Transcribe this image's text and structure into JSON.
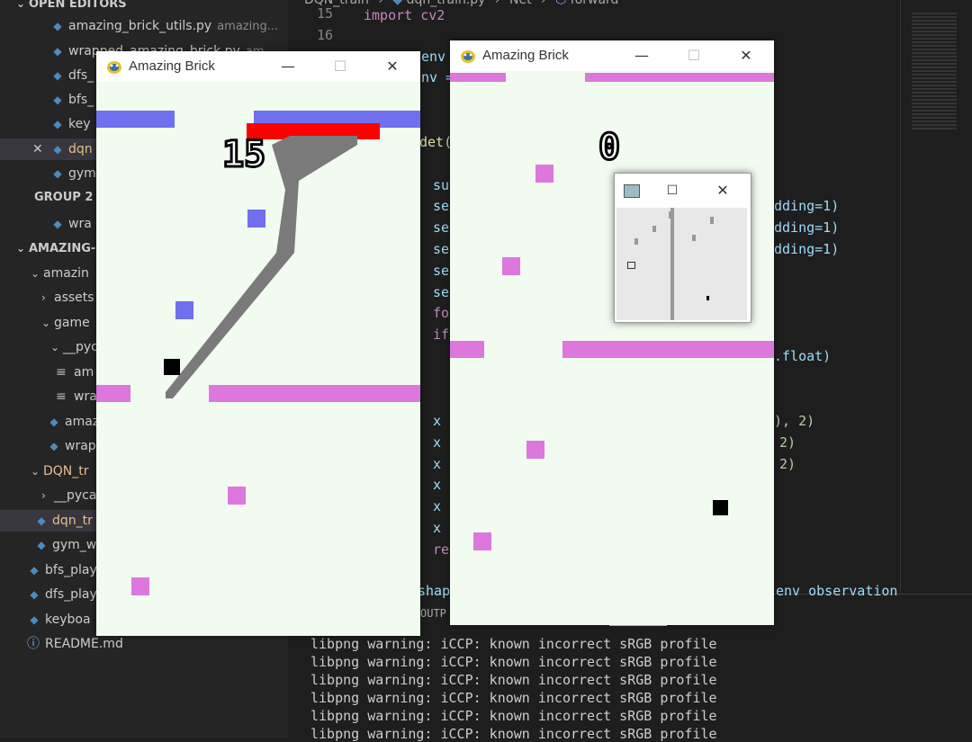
{
  "sidebar": {
    "open_editors_header": "OPEN EDITORS",
    "open_editors": [
      {
        "name": "amazing_brick_utils.py",
        "desc": "amazing..."
      },
      {
        "name": "wrapped_amazing_brick.py",
        "desc": "am..."
      },
      {
        "name": "dfs_"
      },
      {
        "name": "bfs_"
      },
      {
        "name": "key"
      },
      {
        "name": "dqn"
      },
      {
        "name": "gym"
      }
    ],
    "group2_header": "GROUP 2",
    "group2_items": [
      {
        "name": "wra"
      }
    ],
    "workspace_header": "AMAZING-",
    "tree": [
      {
        "name": "amazin"
      },
      {
        "name": "assets"
      },
      {
        "name": "game"
      },
      {
        "name": "__pyc"
      },
      {
        "name": "am"
      },
      {
        "name": "wra"
      },
      {
        "name": "amaz"
      },
      {
        "name": "wrap"
      },
      {
        "name": "DQN_tr"
      },
      {
        "name": "__pyca"
      },
      {
        "name": "dqn_tr"
      },
      {
        "name": "gym_w"
      },
      {
        "name": "bfs_play"
      },
      {
        "name": "dfs_play"
      },
      {
        "name": "keyboa"
      },
      {
        "name": "README.md"
      }
    ]
  },
  "editor": {
    "breadcrumb": [
      "DQN_train",
      "dqn_train.py",
      "Net",
      "forward"
    ],
    "line_numbers": [
      "15",
      "16"
    ],
    "code_fragments": [
      "import cv2",
      "env",
      "nv =",
      "det(",
      "su",
      "se",
      "se",
      "se",
      "se",
      "se",
      "fo",
      "if",
      "x",
      "x",
      "x",
      "x",
      "x",
      "x",
      "re"
    ],
    "code_right_fragments": [
      "dding=1)",
      "dding=1)",
      "dding=1)",
      ".float)",
      "), 2)",
      "2)",
      "2)"
    ],
    "panel_fragment_left": "OUTP",
    "panel_fragment_mid": "shape",
    "panel_fragment_right": "env observation"
  },
  "terminal": {
    "lines": [
      "libpng warning: iCCP: known incorrect sRGB profile",
      "libpng warning: iCCP: known incorrect sRGB profile",
      "libpng warning: iCCP: known incorrect sRGB profile",
      "libpng warning: iCCP: known incorrect sRGB profile",
      "libpng warning: iCCP: known incorrect sRGB profile",
      "libpng warning: iCCP: known incorrect sRGB profile"
    ]
  },
  "game_left": {
    "title": "Amazing Brick",
    "score": "15"
  },
  "game_right": {
    "title": "Amazing Brick",
    "score": "0"
  },
  "obs_window": {
    "title": ""
  },
  "colors": {
    "pink": "#dd77dd",
    "blue": "#7070ee",
    "red": "#ff0000",
    "trail": "#777777",
    "game_bg": "#f1fbf0"
  }
}
